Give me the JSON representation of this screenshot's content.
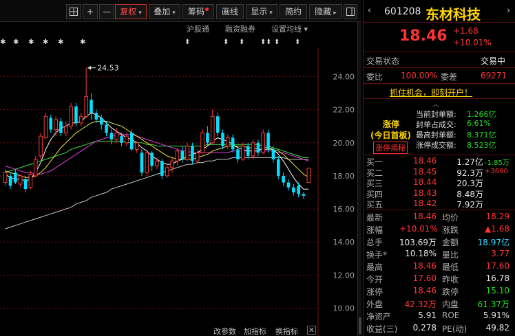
{
  "toolbar": {
    "grid_icon": "grid-icon",
    "zoom_in": "+",
    "zoom_out": "—",
    "fuquan": "复权",
    "overlay": "叠加",
    "chouma": "筹码",
    "huaxian": "画线",
    "display": "显示",
    "jianyue": "简约",
    "hide": "隐藏",
    "expand": "▸"
  },
  "chart_header": {
    "hugutong": "沪股通",
    "rongzi": "融资融券",
    "set_ma": "设置均线"
  },
  "chart_footer": {
    "gai_canshu": "改参数",
    "jia_zhibiao": "加指标",
    "huan_zhibiao": "换指标"
  },
  "chart_data": {
    "type": "candlestick",
    "y_axis_ticks": [
      "24.00",
      "22.00",
      "20.00",
      "18.00",
      "16.00",
      "14.00",
      "12.00",
      "10.00"
    ],
    "ylim": [
      8.9,
      25.1
    ],
    "annotation": "24.53",
    "annotation_value": 24.53,
    "candles": [
      {
        "o": 17.6,
        "c": 18.2,
        "h": 18.4,
        "l": 17.4
      },
      {
        "o": 18.0,
        "c": 17.4,
        "h": 18.2,
        "l": 17.2
      },
      {
        "o": 18.2,
        "c": 17.6,
        "h": 18.4,
        "l": 17.5
      },
      {
        "o": 17.5,
        "c": 18.0,
        "h": 18.1,
        "l": 17.3
      },
      {
        "o": 17.8,
        "c": 17.2,
        "h": 18.0,
        "l": 17.0
      },
      {
        "o": 17.3,
        "c": 18.1,
        "h": 18.3,
        "l": 17.2
      },
      {
        "o": 18.0,
        "c": 19.0,
        "h": 19.2,
        "l": 17.9
      },
      {
        "o": 19.2,
        "c": 20.4,
        "h": 20.6,
        "l": 19.0
      },
      {
        "o": 20.3,
        "c": 21.6,
        "h": 21.8,
        "l": 20.2
      },
      {
        "o": 21.5,
        "c": 20.8,
        "h": 21.7,
        "l": 20.6
      },
      {
        "o": 20.8,
        "c": 21.4,
        "h": 21.6,
        "l": 20.4
      },
      {
        "o": 21.3,
        "c": 20.6,
        "h": 21.5,
        "l": 20.4
      },
      {
        "o": 20.6,
        "c": 21.0,
        "h": 21.3,
        "l": 20.4
      },
      {
        "o": 21.0,
        "c": 22.2,
        "h": 22.4,
        "l": 20.8
      },
      {
        "o": 22.2,
        "c": 21.2,
        "h": 22.4,
        "l": 21.0
      },
      {
        "o": 21.2,
        "c": 21.6,
        "h": 21.8,
        "l": 21.0
      },
      {
        "o": 21.6,
        "c": 22.8,
        "h": 24.53,
        "l": 21.5
      },
      {
        "o": 22.6,
        "c": 21.8,
        "h": 23.0,
        "l": 21.4
      },
      {
        "o": 21.8,
        "c": 21.4,
        "h": 22.0,
        "l": 21.2
      },
      {
        "o": 21.5,
        "c": 21.1,
        "h": 21.7,
        "l": 20.8
      },
      {
        "o": 21.1,
        "c": 20.6,
        "h": 21.3,
        "l": 20.4
      },
      {
        "o": 20.6,
        "c": 20.2,
        "h": 20.8,
        "l": 19.9
      },
      {
        "o": 20.2,
        "c": 20.6,
        "h": 20.9,
        "l": 20.0
      },
      {
        "o": 20.4,
        "c": 20.0,
        "h": 20.6,
        "l": 19.8
      },
      {
        "o": 20.0,
        "c": 20.4,
        "h": 20.6,
        "l": 19.8
      },
      {
        "o": 20.6,
        "c": 19.6,
        "h": 20.8,
        "l": 19.5
      },
      {
        "o": 19.6,
        "c": 20.0,
        "h": 20.1,
        "l": 19.4
      },
      {
        "o": 19.4,
        "c": 18.2,
        "h": 19.6,
        "l": 18.0
      },
      {
        "o": 18.2,
        "c": 19.4,
        "h": 19.6,
        "l": 18.0
      },
      {
        "o": 19.4,
        "c": 18.6,
        "h": 19.5,
        "l": 18.3
      },
      {
        "o": 18.6,
        "c": 18.9,
        "h": 19.1,
        "l": 18.4
      },
      {
        "o": 18.9,
        "c": 18.0,
        "h": 19.0,
        "l": 17.8
      },
      {
        "o": 18.0,
        "c": 18.5,
        "h": 18.7,
        "l": 17.9
      },
      {
        "o": 18.5,
        "c": 18.9,
        "h": 19.1,
        "l": 18.2
      },
      {
        "o": 18.9,
        "c": 19.5,
        "h": 19.6,
        "l": 18.6
      },
      {
        "o": 19.5,
        "c": 19.0,
        "h": 19.8,
        "l": 18.8
      },
      {
        "o": 19.0,
        "c": 19.8,
        "h": 20.0,
        "l": 18.9
      },
      {
        "o": 19.8,
        "c": 18.9,
        "h": 20.0,
        "l": 18.7
      },
      {
        "o": 18.9,
        "c": 19.4,
        "h": 19.6,
        "l": 18.8
      },
      {
        "o": 19.4,
        "c": 20.6,
        "h": 20.8,
        "l": 19.3
      },
      {
        "o": 20.6,
        "c": 20.0,
        "h": 21.0,
        "l": 19.8
      },
      {
        "o": 20.0,
        "c": 21.6,
        "h": 22.0,
        "l": 19.9
      },
      {
        "o": 21.6,
        "c": 20.6,
        "h": 21.8,
        "l": 20.4
      },
      {
        "o": 20.6,
        "c": 19.8,
        "h": 20.8,
        "l": 19.6
      },
      {
        "o": 19.8,
        "c": 20.3,
        "h": 20.5,
        "l": 19.6
      },
      {
        "o": 20.3,
        "c": 19.6,
        "h": 20.5,
        "l": 19.4
      },
      {
        "o": 19.6,
        "c": 19.0,
        "h": 19.8,
        "l": 18.8
      },
      {
        "o": 19.0,
        "c": 19.8,
        "h": 20.0,
        "l": 18.9
      },
      {
        "o": 19.8,
        "c": 19.2,
        "h": 20.0,
        "l": 19.0
      },
      {
        "o": 19.2,
        "c": 20.0,
        "h": 20.2,
        "l": 19.0
      },
      {
        "o": 20.0,
        "c": 19.4,
        "h": 20.2,
        "l": 19.2
      },
      {
        "o": 19.4,
        "c": 20.6,
        "h": 20.8,
        "l": 19.3
      },
      {
        "o": 20.6,
        "c": 19.6,
        "h": 20.8,
        "l": 19.4
      },
      {
        "o": 19.6,
        "c": 19.0,
        "h": 19.8,
        "l": 18.8
      },
      {
        "o": 19.0,
        "c": 18.0,
        "h": 19.2,
        "l": 17.8
      },
      {
        "o": 18.0,
        "c": 17.6,
        "h": 18.2,
        "l": 17.4
      },
      {
        "o": 17.6,
        "c": 17.3,
        "h": 17.8,
        "l": 17.1
      },
      {
        "o": 17.3,
        "c": 17.0,
        "h": 17.5,
        "l": 16.8
      },
      {
        "o": 17.4,
        "c": 16.9,
        "h": 17.6,
        "l": 16.7
      },
      {
        "o": 16.9,
        "c": 16.8,
        "h": 17.0,
        "l": 16.6
      },
      {
        "o": 17.6,
        "c": 18.46,
        "h": 18.46,
        "l": 17.6
      }
    ],
    "ma5": [
      18.1,
      17.9,
      17.8,
      17.8,
      17.7,
      17.8,
      18.2,
      18.8,
      19.6,
      20.2,
      20.6,
      20.9,
      21.0,
      21.2,
      21.2,
      21.3,
      21.6,
      21.8,
      21.7,
      21.5,
      21.2,
      20.9,
      20.7,
      20.5,
      20.3,
      20.2,
      20.0,
      19.7,
      19.5,
      19.2,
      19.0,
      18.8,
      18.7,
      18.7,
      18.9,
      19.0,
      19.2,
      19.3,
      19.4,
      19.6,
      19.8,
      20.1,
      20.3,
      20.2,
      20.1,
      19.9,
      19.7,
      19.6,
      19.5,
      19.5,
      19.5,
      19.7,
      19.7,
      19.6,
      19.3,
      18.9,
      18.4,
      17.9,
      17.5,
      17.2,
      17.2
    ],
    "ma10": [
      18.3,
      18.2,
      18.1,
      18.0,
      17.9,
      17.9,
      18.0,
      18.2,
      18.5,
      18.9,
      19.3,
      19.7,
      20.0,
      20.3,
      20.6,
      20.8,
      21.0,
      21.2,
      21.3,
      21.3,
      21.3,
      21.2,
      21.1,
      21.0,
      20.8,
      20.6,
      20.4,
      20.2,
      20.0,
      19.8,
      19.6,
      19.4,
      19.2,
      19.1,
      19.0,
      19.0,
      19.0,
      19.0,
      19.1,
      19.2,
      19.3,
      19.5,
      19.6,
      19.7,
      19.8,
      19.8,
      19.8,
      19.8,
      19.7,
      19.7,
      19.6,
      19.6,
      19.6,
      19.6,
      19.5,
      19.3,
      19.0,
      18.7,
      18.4,
      18.1,
      17.9
    ],
    "ma20": [
      18.6,
      18.5,
      18.4,
      18.3,
      18.2,
      18.2,
      18.1,
      18.1,
      18.2,
      18.3,
      18.5,
      18.7,
      18.9,
      19.1,
      19.3,
      19.5,
      19.7,
      19.9,
      20.1,
      20.2,
      20.3,
      20.4,
      20.5,
      20.5,
      20.5,
      20.5,
      20.4,
      20.3,
      20.2,
      20.1,
      20.0,
      19.9,
      19.8,
      19.7,
      19.6,
      19.5,
      19.5,
      19.4,
      19.4,
      19.4,
      19.4,
      19.4,
      19.4,
      19.4,
      19.4,
      19.5,
      19.5,
      19.5,
      19.5,
      19.5,
      19.5,
      19.5,
      19.5,
      19.5,
      19.4,
      19.4,
      19.3,
      19.2,
      19.1,
      19.0,
      18.9
    ],
    "ma30": [
      18.2,
      18.3,
      18.4,
      18.5,
      18.6,
      18.7,
      18.8,
      18.9,
      19.0,
      19.1,
      19.2,
      19.3,
      19.4,
      19.6,
      19.7,
      19.8,
      19.9,
      20.0,
      20.1,
      20.1,
      20.1,
      20.1,
      20.1,
      20.1,
      20.0,
      20.0,
      20.0,
      20.0,
      19.9,
      19.9,
      19.8,
      19.8,
      19.8,
      19.8,
      19.8,
      19.8,
      19.8,
      19.8,
      19.8,
      19.8,
      19.9,
      19.9,
      19.9,
      19.9,
      19.9,
      19.9,
      19.9,
      19.9,
      19.9,
      19.9,
      19.9,
      19.8,
      19.8,
      19.7,
      19.6,
      19.5,
      19.4,
      19.3,
      19.2,
      19.1,
      19.1
    ],
    "ma60": [
      14.8,
      14.9,
      15.0,
      15.1,
      15.2,
      15.3,
      15.4,
      15.5,
      15.6,
      15.7,
      15.8,
      15.9,
      16.0,
      16.1,
      16.3,
      16.4,
      16.5,
      16.7,
      16.8,
      16.9,
      17.0,
      17.2,
      17.3,
      17.4,
      17.5,
      17.6,
      17.7,
      17.8,
      17.9,
      18.0,
      18.1,
      18.2,
      18.3,
      18.4,
      18.5,
      18.6,
      18.7,
      18.7,
      18.8,
      18.8,
      18.9,
      18.9,
      19.0,
      19.0,
      19.0,
      19.1,
      19.1,
      19.1,
      19.1,
      19.1,
      19.1,
      19.1,
      19.1,
      19.1,
      19.1,
      19.1,
      19.0,
      19.0,
      19.0,
      19.0,
      19.0
    ],
    "colors": {
      "up": "#ff3b3b",
      "down": "#00e0ff",
      "ma5": "#ffffff",
      "ma10": "#f0e040",
      "ma20": "#e040e0",
      "ma30": "#40e040",
      "ma60": "#c8c8c8",
      "grid": "#7a1010",
      "axis_text": "#a0a0a0"
    }
  },
  "quote": {
    "code": "601208",
    "name": "东材科技",
    "price": "18.46",
    "change": "+1.68",
    "change_pct": "+10.01%",
    "trade_status_label": "交易状态",
    "trade_status": "交易中",
    "weibi_label": "委比",
    "weibi": "100.00%",
    "weicha_label": "委差",
    "weicha": "69271",
    "ad": "抓住机会，即刻开户！",
    "limit_title": "涨停",
    "limit_sub": "(今日首板)",
    "limit_reveal": "涨停揭秘",
    "limit_stats": [
      {
        "label": "当前封单额:",
        "value": "1.266亿"
      },
      {
        "label": "封单占成交:",
        "value": "6.61%"
      },
      {
        "label": "最高封单额:",
        "value": "8.371亿"
      },
      {
        "label": "涨停成交额:",
        "value": "8.523亿"
      }
    ],
    "bids": [
      {
        "label": "买一",
        "price": "18.46",
        "vol": "1.27亿",
        "delta": "-1.85万"
      },
      {
        "label": "买二",
        "price": "18.45",
        "vol": "92.3万",
        "delta": "+3690"
      },
      {
        "label": "买三",
        "price": "18.44",
        "vol": "20.3万",
        "delta": ""
      },
      {
        "label": "买四",
        "price": "18.43",
        "vol": "8.48万",
        "delta": ""
      },
      {
        "label": "买五",
        "price": "18.42",
        "vol": "7.92万",
        "delta": ""
      }
    ],
    "stats": [
      {
        "l1": "最新",
        "v1": "18.46",
        "c1": "red",
        "l2": "均价",
        "v2": "18.29",
        "c2": "red"
      },
      {
        "l1": "涨幅",
        "v1": "+10.01%",
        "c1": "red",
        "l2": "涨跌",
        "v2": "▲1.68",
        "c2": "red"
      },
      {
        "l1": "总手",
        "v1": "103.69万",
        "c1": "white",
        "l2": "金额",
        "v2": "18.97亿",
        "c2": "cyan"
      },
      {
        "l1": "换手*",
        "v1": "10.18%",
        "c1": "white",
        "l2": "量比",
        "v2": "3.77",
        "c2": "red"
      },
      {
        "l1": "最高",
        "v1": "18.46",
        "c1": "red",
        "l2": "最低",
        "v2": "17.60",
        "c2": "red"
      },
      {
        "l1": "今开",
        "v1": "17.60",
        "c1": "red",
        "l2": "昨收",
        "v2": "16.78",
        "c2": "white"
      },
      {
        "l1": "涨停",
        "v1": "18.46",
        "c1": "red",
        "l2": "跌停",
        "v2": "15.10",
        "c2": "green"
      },
      {
        "l1": "外盘",
        "v1": "42.32万",
        "c1": "red",
        "l2": "内盘",
        "v2": "61.37万",
        "c2": "green"
      },
      {
        "l1": "净资产",
        "v1": "5.91",
        "c1": "white",
        "l2": "ROE",
        "v2": "5.91%",
        "c2": "white"
      },
      {
        "l1": "收益(三)",
        "v1": "0.278",
        "c1": "white",
        "l2": "PE(动)",
        "v2": "49.82",
        "c2": "white"
      }
    ]
  }
}
